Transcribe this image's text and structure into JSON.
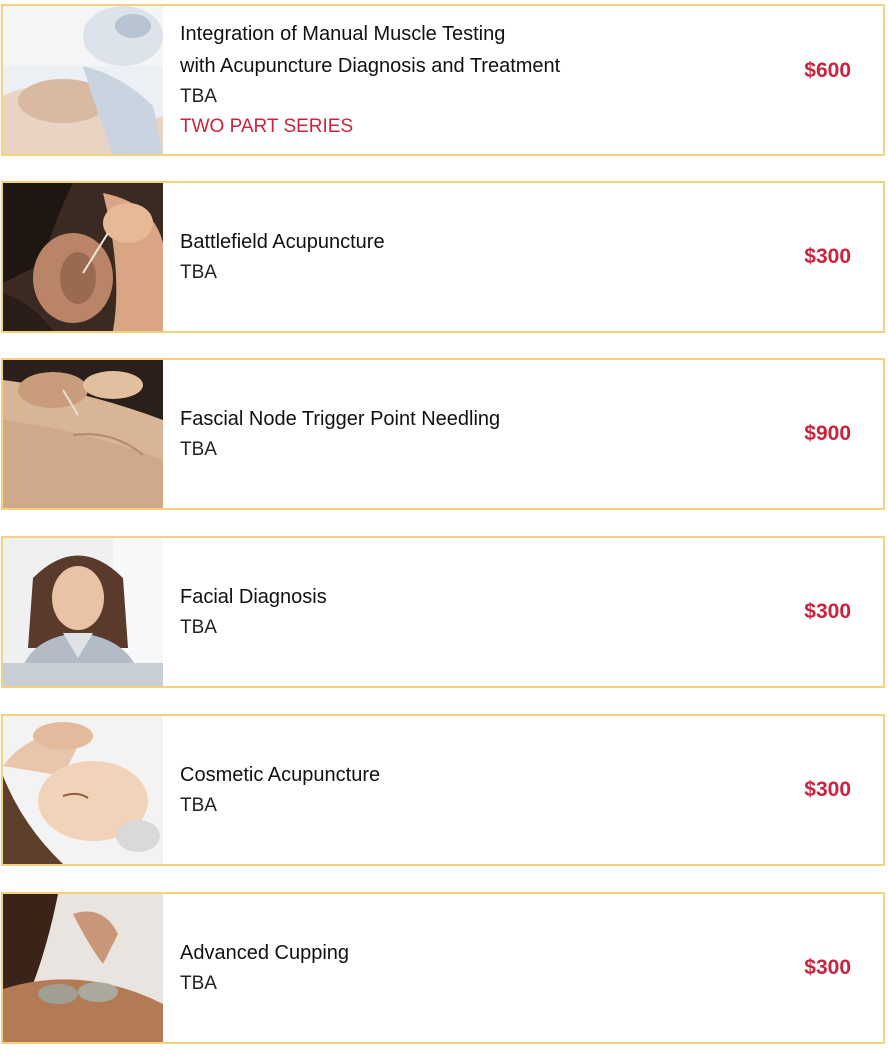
{
  "courses": [
    {
      "title_line1": "Integration of Manual Muscle Testing",
      "title_line2": "with Acupuncture Diagnosis and Treatment",
      "date": "TBA",
      "series": "TWO PART SERIES",
      "price": "$600",
      "image": "manual-muscle-testing-photo"
    },
    {
      "title_line1": "Battlefield Acupuncture",
      "date": "TBA",
      "price": "$300",
      "image": "ear-acupuncture-photo"
    },
    {
      "title_line1": "Fascial Node Trigger Point Needling",
      "date": "TBA",
      "price": "$900",
      "image": "needling-photo"
    },
    {
      "title_line1": "Facial Diagnosis",
      "date": "TBA",
      "price": "$300",
      "image": "smiling-woman-photo"
    },
    {
      "title_line1": "Cosmetic Acupuncture",
      "date": "TBA",
      "price": "$300",
      "image": "facial-massage-photo"
    },
    {
      "title_line1": "Advanced Cupping",
      "date": "TBA",
      "price": "$300",
      "image": "cupping-photo"
    }
  ],
  "colors": {
    "border": "#f5d27a",
    "accent": "#c9243f",
    "text": "#111111"
  }
}
